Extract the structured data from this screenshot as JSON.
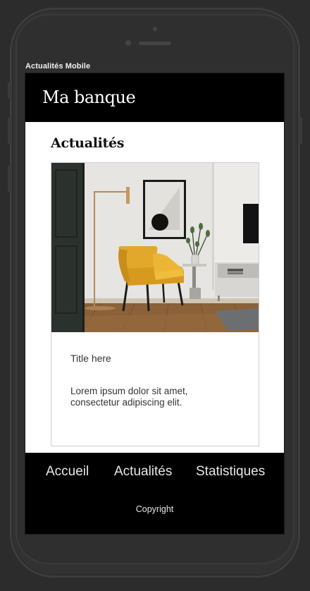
{
  "frame_label": "Actualités Mobile",
  "header": {
    "title": "Ma banque"
  },
  "main": {
    "section_title": "Actualités",
    "card": {
      "title": "Title here",
      "text": "Lorem ipsum dolor sit amet, consectetur adipiscing elit."
    }
  },
  "footer": {
    "nav": [
      {
        "label": "Accueil"
      },
      {
        "label": "Actualités"
      },
      {
        "label": "Statistiques"
      }
    ],
    "copyright": "Copyright"
  }
}
